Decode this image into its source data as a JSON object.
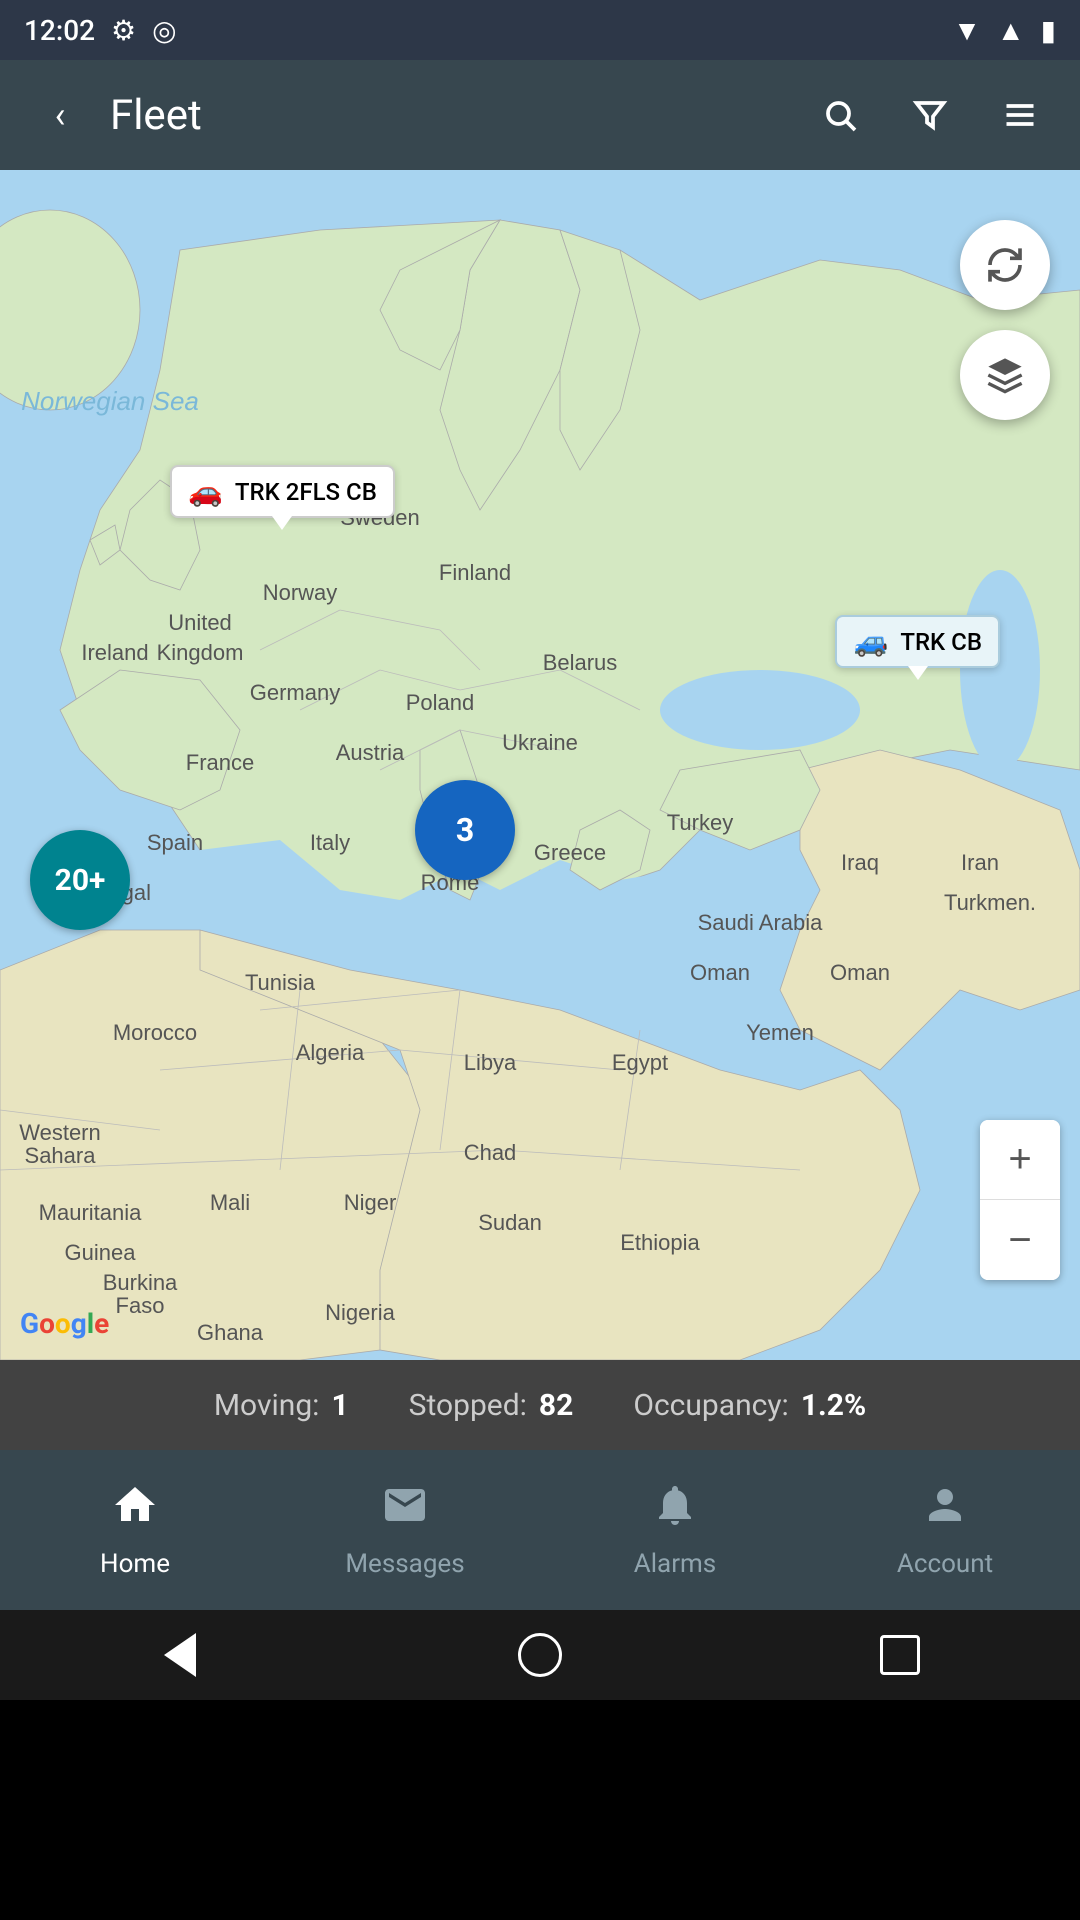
{
  "status_bar": {
    "time": "12:02"
  },
  "app_bar": {
    "back_label": "‹",
    "title": "Fleet",
    "search_label": "search",
    "filter_label": "filter",
    "menu_label": "menu"
  },
  "map": {
    "refresh_label": "↻",
    "layers_label": "◆",
    "marker1": {
      "id": "trk-2fls-cb",
      "label": "TRK 2FLS CB",
      "type": "moving"
    },
    "marker2": {
      "id": "trk-cb",
      "label": "TRK CB",
      "type": "stopped"
    },
    "cluster1": {
      "label": "20+",
      "color": "#00838f"
    },
    "cluster2": {
      "label": "3",
      "color": "#1565c0"
    },
    "zoom_in": "+",
    "zoom_out": "−",
    "google_logo": "Google"
  },
  "stats": {
    "moving_label": "Moving:",
    "moving_value": "1",
    "stopped_label": "Stopped:",
    "stopped_value": "82",
    "occupancy_label": "Occupancy:",
    "occupancy_value": "1.2%"
  },
  "bottom_nav": {
    "items": [
      {
        "id": "home",
        "label": "Home",
        "icon": "🏠",
        "active": true
      },
      {
        "id": "messages",
        "label": "Messages",
        "icon": "✉",
        "active": false
      },
      {
        "id": "alarms",
        "label": "Alarms",
        "icon": "🔔",
        "active": false
      },
      {
        "id": "account",
        "label": "Account",
        "icon": "👤",
        "active": false
      }
    ]
  },
  "system_nav": {
    "back": "back",
    "home": "home",
    "recents": "recents"
  }
}
